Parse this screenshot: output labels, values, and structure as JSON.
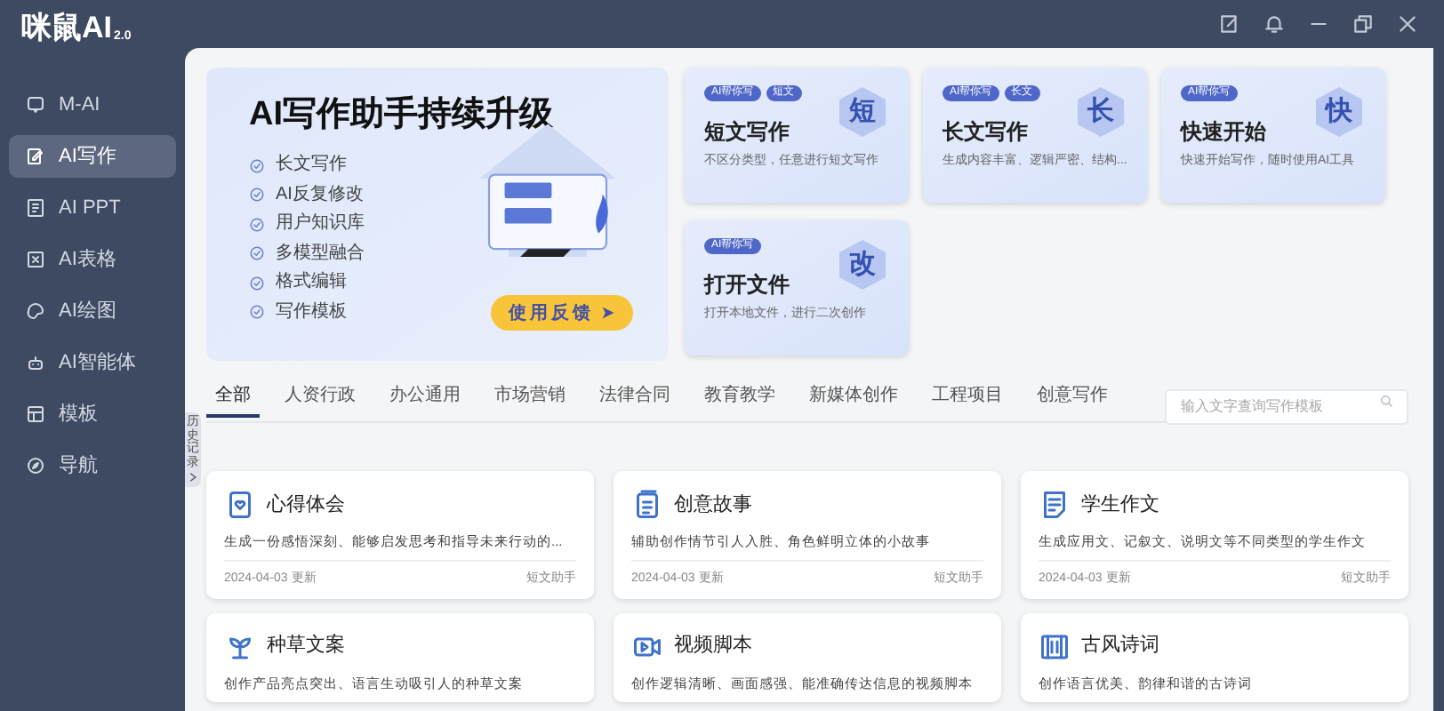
{
  "app": {
    "logo": "咪鼠AI",
    "version": "2.0"
  },
  "sidebar": {
    "items": [
      {
        "label": "M-AI",
        "selected": false
      },
      {
        "label": "AI写作",
        "selected": true
      },
      {
        "label": "AI PPT",
        "selected": false
      },
      {
        "label": "AI表格",
        "selected": false
      },
      {
        "label": "AI绘图",
        "selected": false
      },
      {
        "label": "AI智能体",
        "selected": false
      },
      {
        "label": "模板",
        "selected": false
      },
      {
        "label": "导航",
        "selected": false
      }
    ]
  },
  "history_tab": "历史记录",
  "banner": {
    "title": "AI写作助手持续升级",
    "features": [
      "长文写作",
      "AI反复修改",
      "用户知识库",
      "多模型融合",
      "格式编辑",
      "写作模板"
    ],
    "button": "使用反馈"
  },
  "quick_cards": [
    {
      "tags": [
        "AI帮你写",
        "短文"
      ],
      "glyph": "短",
      "title": "短文写作",
      "description": "不区分类型，任意进行短文写作"
    },
    {
      "tags": [
        "AI帮你写",
        "长文"
      ],
      "glyph": "长",
      "title": "长文写作",
      "description": "生成内容丰富、逻辑严密、结构..."
    },
    {
      "tags": [
        "AI帮你写"
      ],
      "glyph": "快",
      "title": "快速开始",
      "description": "快速开始写作，随时使用AI工具"
    },
    {
      "tags": [
        "AI帮你写"
      ],
      "glyph": "改",
      "title": "打开文件",
      "description": "打开本地文件，进行二次创作"
    }
  ],
  "category_tabs": [
    {
      "label": "全部",
      "selected": true
    },
    {
      "label": "人资行政",
      "selected": false
    },
    {
      "label": "办公通用",
      "selected": false
    },
    {
      "label": "市场营销",
      "selected": false
    },
    {
      "label": "法律合同",
      "selected": false
    },
    {
      "label": "教育教学",
      "selected": false
    },
    {
      "label": "新媒体创作",
      "selected": false
    },
    {
      "label": "工程项目",
      "selected": false
    },
    {
      "label": "创意写作",
      "selected": false
    }
  ],
  "search": {
    "placeholder": "输入文字查询写作模板"
  },
  "templates": [
    {
      "title": "心得体会",
      "description": "生成一份感悟深刻、能够启发思考和指导未来行动的...",
      "date": "2024-04-03 更新",
      "tag": "短文助手"
    },
    {
      "title": "创意故事",
      "description": "辅助创作情节引人入胜、角色鲜明立体的小故事",
      "date": "2024-04-03 更新",
      "tag": "短文助手"
    },
    {
      "title": "学生作文",
      "description": "生成应用文、记叙文、说明文等不同类型的学生作文",
      "date": "2024-04-03 更新",
      "tag": "短文助手"
    },
    {
      "title": "种草文案",
      "description": "创作产品亮点突出、语言生动吸引人的种草文案"
    },
    {
      "title": "视频脚本",
      "description": "创作逻辑清晰、画面感强、能准确传达信息的视频脚本"
    },
    {
      "title": "古风诗词",
      "description": "创作语言优美、韵律和谐的古诗词"
    }
  ]
}
